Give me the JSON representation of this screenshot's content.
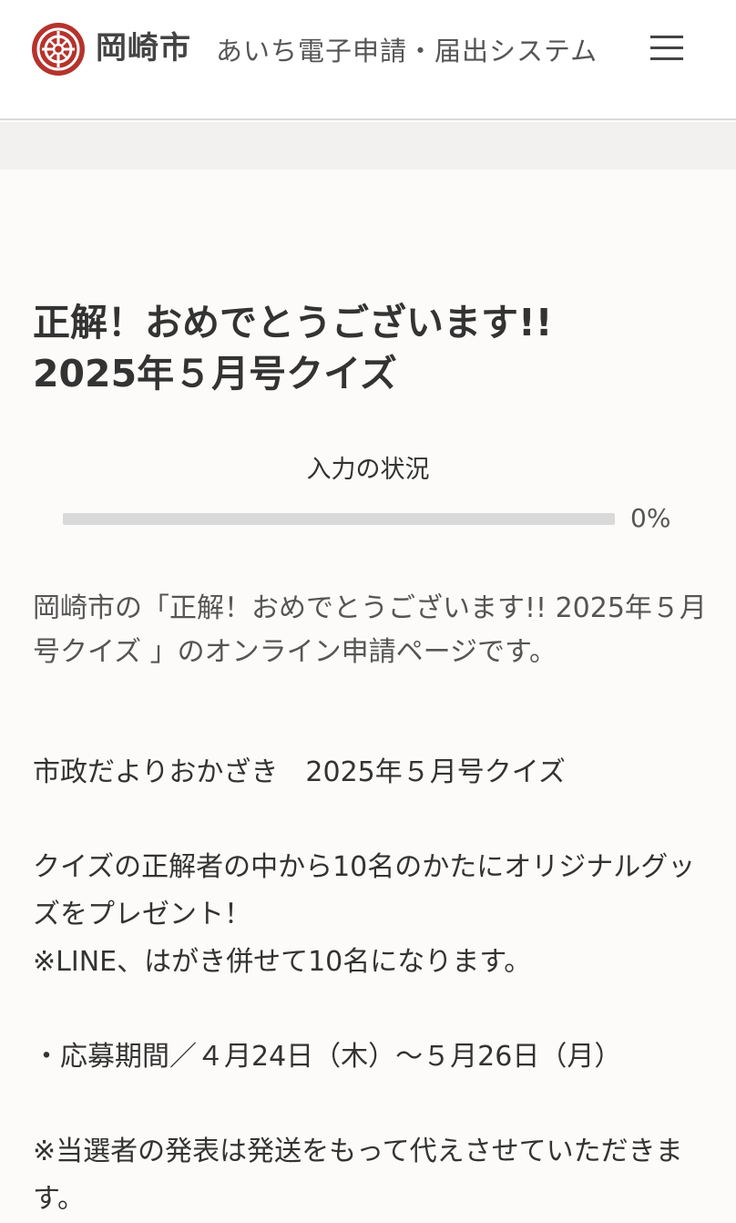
{
  "header": {
    "logo_text": "岡崎市",
    "system_title": "あいち電子申請・届出システム",
    "menu_icon": "hamburger-menu-icon",
    "brand_color": "#b5332c"
  },
  "form": {
    "title_line1": "正解！おめでとうございます!!",
    "title_line2": "2025年５月号クイズ",
    "progress_label": "入力の状況",
    "progress_value": "0%",
    "progress_fraction": 0
  },
  "content": {
    "intro": "岡崎市の「正解！おめでとうございます!! 2025年５月号クイズ 」のオンライン申請ページです。",
    "line1": "市政だよりおかざき　2025年５月号クイズ",
    "line2": "クイズの正解者の中から10名のかたにオリジナルグッズをプレゼント！",
    "line3": "※LINE、はがき併せて10名になります。",
    "line4": "・応募期間／４月24日（木）～５月26日（月）",
    "line5": "※当選者の発表は発送をもって代えさせていただきます。"
  }
}
